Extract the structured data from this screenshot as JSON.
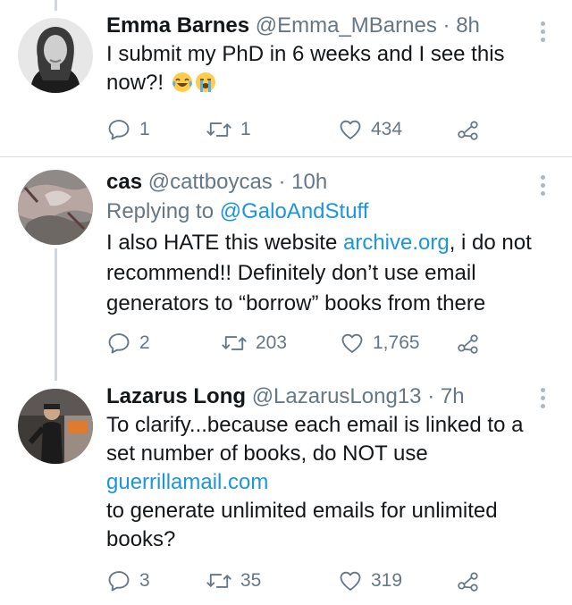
{
  "tweets": [
    {
      "name": "Emma Barnes",
      "handle": "@Emma_MBarnes",
      "separator": "·",
      "time": "8h",
      "text_lines": [
        "I submit my PhD in 6 weeks and I see this",
        "now?!"
      ],
      "emojis": [
        "face-with-tears-of-joy-icon",
        "loudly-crying-face-icon"
      ],
      "replies": "1",
      "retweets": "1",
      "likes": "434"
    },
    {
      "name": "cas",
      "handle": "@cattboycas",
      "separator": "·",
      "time": "10h",
      "replying_prefix": "Replying to",
      "replying_handle": "@GaloAndStuff",
      "text_line1_before": "I also HATE this website ",
      "text_line1_link": "archive.org",
      "text_line1_after": ", i do not",
      "text_line2": "recommend!! Definitely don’t use email",
      "text_line3": "generators to “borrow” books from there",
      "replies": "2",
      "retweets": "203",
      "likes": "1,765"
    },
    {
      "name": "Lazarus Long",
      "handle": "@LazarusLong13",
      "separator": "·",
      "time": "7h",
      "text_line1": "To clarify...because each email is linked to a",
      "text_line2": "set number of books, do NOT use",
      "text_link": "guerrillamail.com",
      "text_line4": "to generate unlimited emails for unlimited",
      "text_line5": "books?",
      "replies": "3",
      "retweets": "35",
      "likes": "319"
    }
  ],
  "icons": {
    "reply": "reply-icon",
    "retweet": "retweet-icon",
    "like": "heart-icon",
    "share": "share-icon",
    "more": "more-options-icon"
  },
  "colors": {
    "text": "#14171a",
    "secondary": "#657786",
    "link": "#1b95e0",
    "divider": "#d9dee2",
    "thread_line": "#cfd6dc"
  }
}
